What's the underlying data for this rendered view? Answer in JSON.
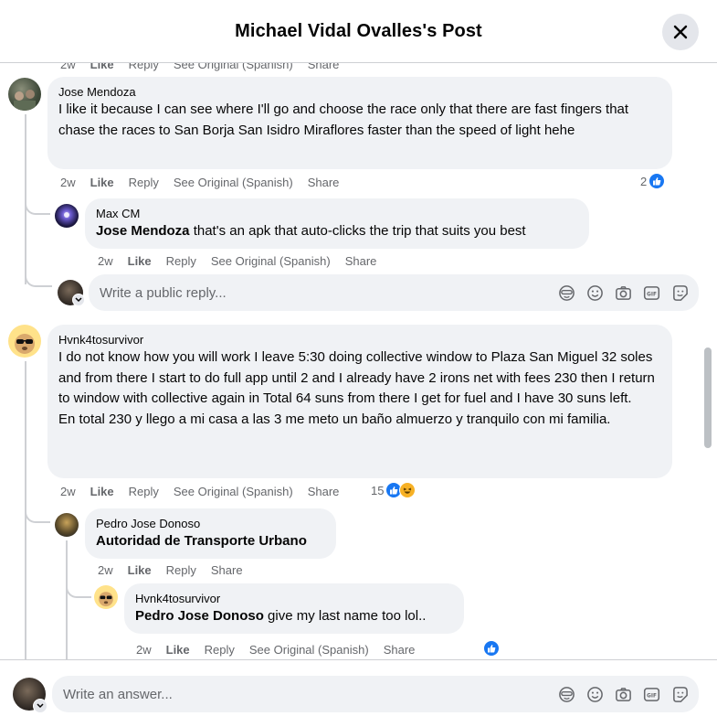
{
  "header": {
    "title": "Michael Vidal Ovalles's Post"
  },
  "top_cut_actions": {
    "time": "2w",
    "like": "Like",
    "reply": "Reply",
    "see_original": "See Original (Spanish)",
    "share": "Share"
  },
  "comments": [
    {
      "author": "Jose Mendoza",
      "text": "I like it because I can see where I'll go and choose the race only that there are fast fingers that chase the races to San Borja San Isidro Miraflores faster than the speed of light hehe",
      "time": "2w",
      "like": "Like",
      "reply": "Reply",
      "see_original": "See Original (Spanish)",
      "share": "Share",
      "reaction_count": "2",
      "replies": [
        {
          "author": "Max CM",
          "mention": "Jose Mendoza",
          "text": " that's an apk that auto-clicks the trip that suits you best",
          "time": "2w",
          "like": "Like",
          "reply": "Reply",
          "see_original": "See Original (Spanish)",
          "share": "Share"
        }
      ],
      "reply_placeholder": "Write a public reply..."
    },
    {
      "author": "Hvnk4tosurvivor",
      "text": "I do not know how you will work I leave 5:30 doing collective window to Plaza San Miguel 32 soles and from there I start to do full app until 2 and I already have 2 irons net with fees 230 then I return to window with collective again in Total 64 suns from there I get for fuel and I have 30 suns left.\nEn total 230 y llego a mi casa a las 3 me meto un baño almuerzo y tranquilo con mi familia.",
      "time": "2w",
      "like": "Like",
      "reply": "Reply",
      "see_original": "See Original (Spanish)",
      "share": "Share",
      "reaction_count": "15",
      "replies": [
        {
          "author": "Pedro Jose Donoso",
          "mention": "Autoridad de Transporte Urbano",
          "text": "",
          "time": "2w",
          "like": "Like",
          "reply": "Reply",
          "share": "Share"
        },
        {
          "author": "Hvnk4tosurvivor",
          "mention": "Pedro Jose Donoso",
          "text": " give my last name too lol..",
          "time": "2w",
          "like": "Like",
          "reply": "Reply",
          "see_original": "See Original (Spanish)",
          "share": "Share"
        }
      ]
    }
  ],
  "footer": {
    "placeholder": "Write an answer..."
  },
  "colors": {
    "accent": "#1877f2",
    "bubble": "#f0f2f5",
    "secondary_text": "#65676b"
  }
}
